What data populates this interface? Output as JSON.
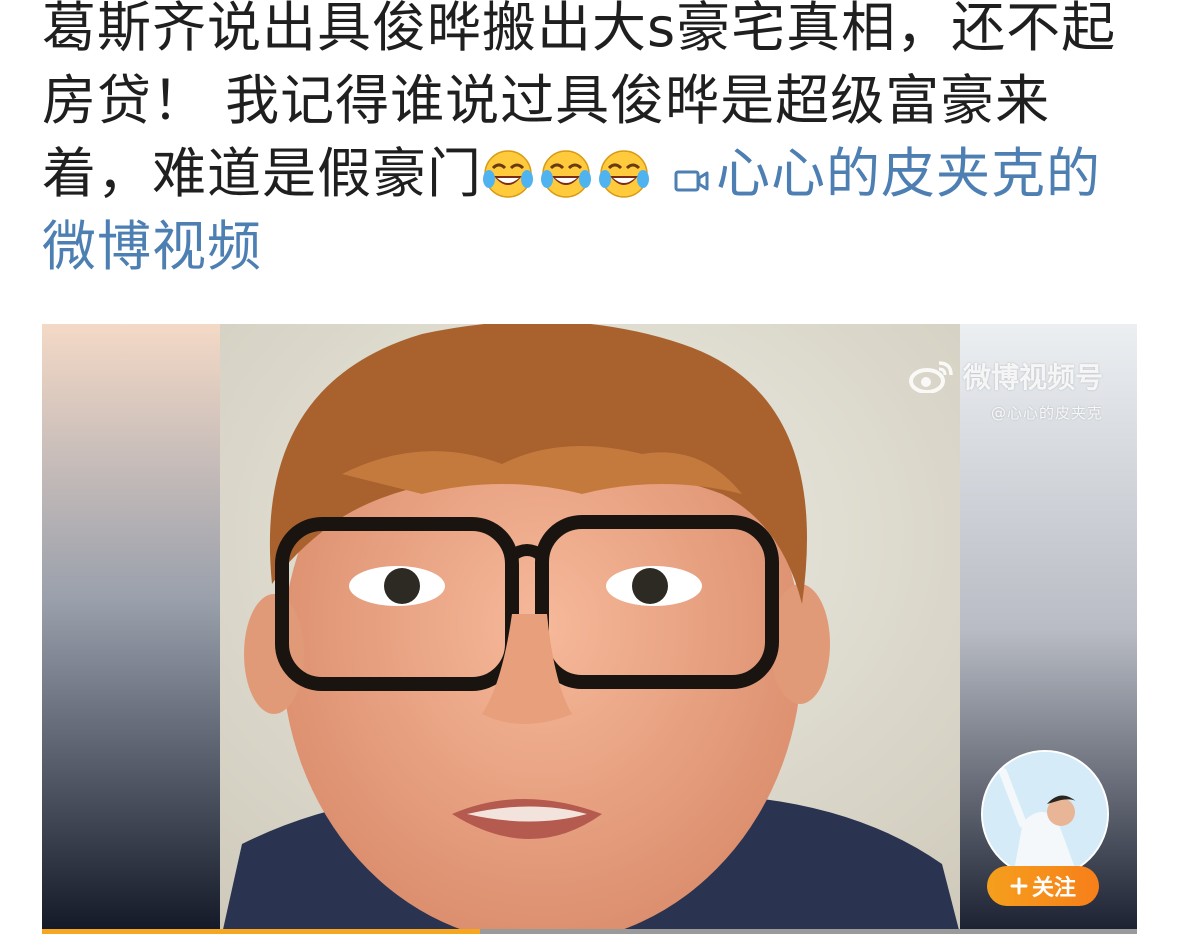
{
  "post": {
    "text": "葛斯齐说出具俊晔搬出大s豪宅真相，还不起房贷！ 我记得谁说过具俊晔是超级富豪来着，难道是假豪门",
    "emojis": [
      "laugh-cry-emoji",
      "laugh-cry-emoji",
      "laugh-cry-emoji"
    ],
    "video_link_label": "心心的皮夹克的微博视频"
  },
  "video": {
    "watermark_title": "微博视频号",
    "watermark_user": "@心心的皮夹克",
    "follow_label": "关注",
    "follow_icon": "plus-icon",
    "progress_fraction": 0.4
  },
  "colors": {
    "link": "#4d7fb3",
    "follow_button": "#f7931e",
    "progress": "#f6a722"
  }
}
